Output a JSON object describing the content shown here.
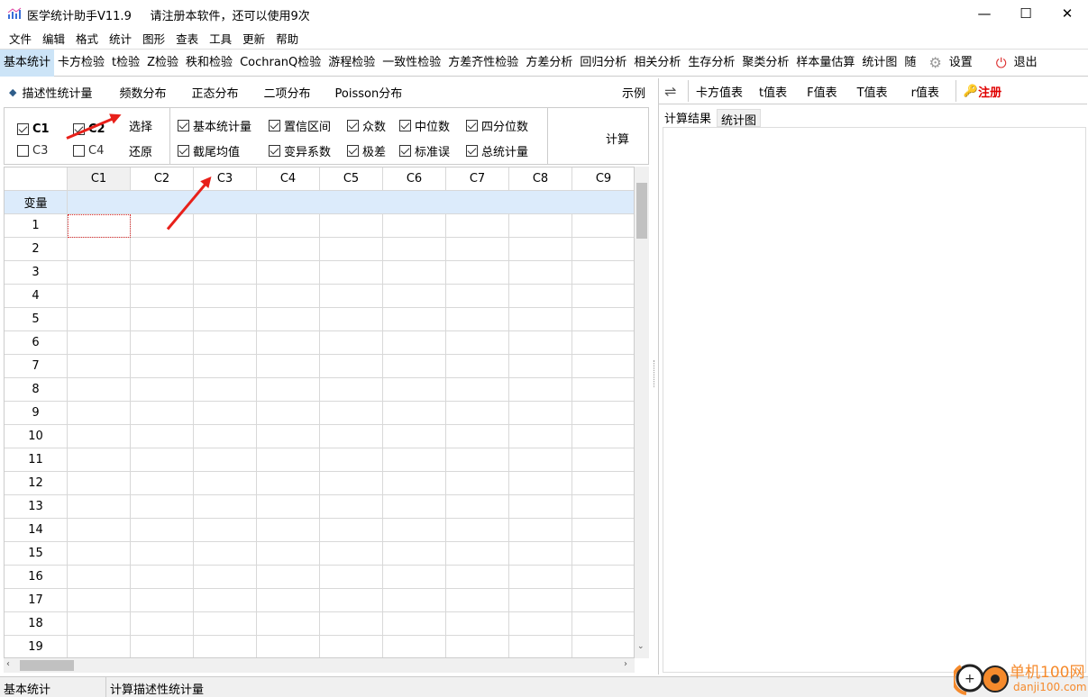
{
  "window": {
    "title": "医学统计助手V11.9     请注册本软件，还可以使用9次",
    "minimize": "—",
    "maximize": "☐",
    "close": "✕"
  },
  "menu": [
    "文件",
    "编辑",
    "格式",
    "统计",
    "图形",
    "查表",
    "工具",
    "更新",
    "帮助"
  ],
  "toolbar": {
    "items": [
      "基本统计",
      "卡方检验",
      "t检验",
      "Z检验",
      "秩和检验",
      "CochranQ检验",
      "游程检验",
      "一致性检验",
      "方差齐性检验",
      "方差分析",
      "回归分析",
      "相关分析",
      "生存分析",
      "聚类分析",
      "样本量估算",
      "统计图",
      "随"
    ],
    "active": "基本统计",
    "settings": "设置",
    "exit": "退出"
  },
  "subbar": {
    "items": [
      "描述性统计量",
      "频数分布",
      "正态分布",
      "二项分布",
      "Poisson分布"
    ],
    "example": "示例"
  },
  "options": {
    "columns": [
      {
        "label": "C1",
        "checked": true
      },
      {
        "label": "C2",
        "checked": true
      },
      {
        "label": "C3",
        "checked": false
      },
      {
        "label": "C4",
        "checked": false
      }
    ],
    "select": "选择",
    "restore": "还原",
    "stats": [
      {
        "label": "基本统计量",
        "checked": true
      },
      {
        "label": "置信区间",
        "checked": true
      },
      {
        "label": "众数",
        "checked": true
      },
      {
        "label": "中位数",
        "checked": true
      },
      {
        "label": "四分位数",
        "checked": true
      },
      {
        "label": "截尾均值",
        "checked": true
      },
      {
        "label": "变异系数",
        "checked": true
      },
      {
        "label": "极差",
        "checked": true
      },
      {
        "label": "标准误",
        "checked": true
      },
      {
        "label": "总统计量",
        "checked": true
      }
    ],
    "compute": "计算"
  },
  "grid": {
    "columns": [
      "C1",
      "C2",
      "C3",
      "C4",
      "C5",
      "C6",
      "C7",
      "C8",
      "C9"
    ],
    "var_row": "变量",
    "rows": [
      "1",
      "2",
      "3",
      "4",
      "5",
      "6",
      "7",
      "8",
      "9",
      "10",
      "11",
      "12",
      "13",
      "14",
      "15",
      "16",
      "17",
      "18",
      "19"
    ]
  },
  "right": {
    "swap": "⇌",
    "tables": [
      "卡方值表",
      "t值表",
      "F值表",
      "T值表",
      "r值表"
    ],
    "register": "注册",
    "tabs": [
      "计算结果",
      "统计图"
    ]
  },
  "status": {
    "left": "基本统计",
    "right": "计算描述性统计量"
  },
  "watermark": {
    "name": "单机100网",
    "url": "danji100.com"
  },
  "colors": {
    "active_tab": "#cce4f7",
    "var_row": "#dcebfb",
    "register": "#e00000",
    "arrow": "#e8201a"
  }
}
